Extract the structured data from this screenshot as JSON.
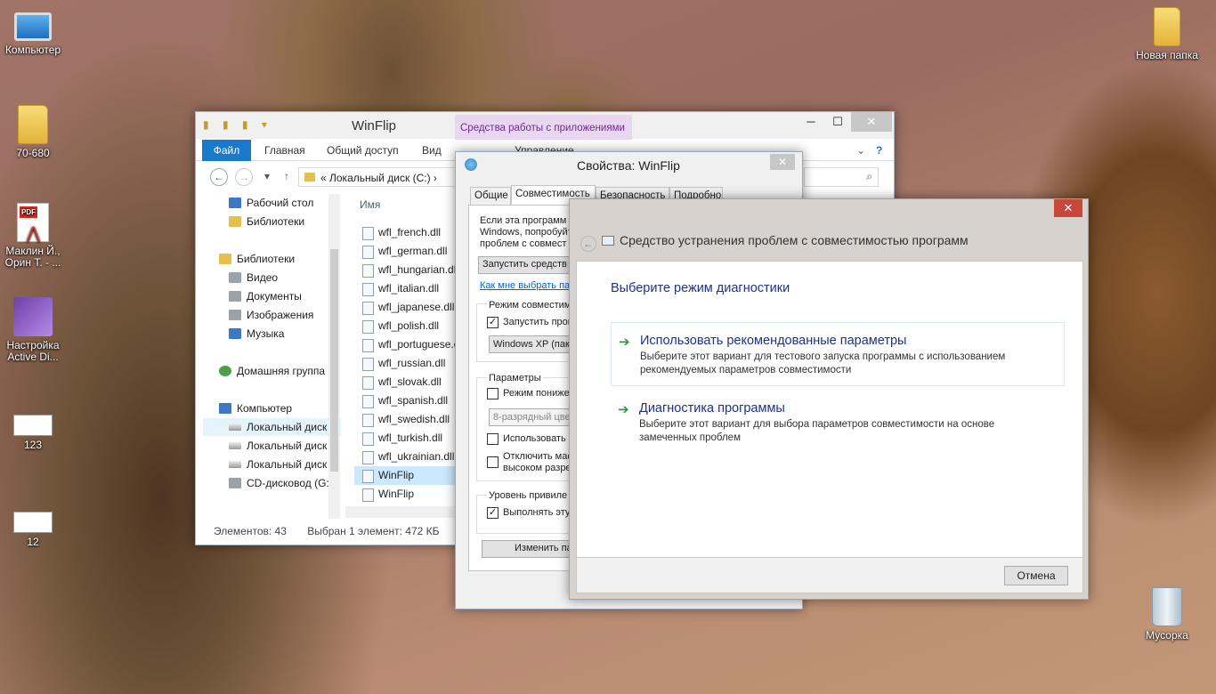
{
  "desktop": {
    "icons": [
      {
        "label": "Компьютер",
        "icon": "computer-icon"
      },
      {
        "label": "70-680",
        "icon": "pdf-folder-icon"
      },
      {
        "label": "Маклин Й., Орин Т. - ...",
        "icon": "pdf-icon"
      },
      {
        "label": "Настройка Active Di...",
        "icon": "visual-studio-icon"
      },
      {
        "label": "123",
        "icon": "document-icon"
      },
      {
        "label": "12",
        "icon": "document-icon"
      },
      {
        "label": "Новая папка",
        "icon": "folder-icon"
      },
      {
        "label": "Мусорка",
        "icon": "recycle-bin-icon"
      }
    ]
  },
  "explorer": {
    "title": "WinFlip",
    "tools_tab": "Средства работы с приложениями",
    "tools_subtab": "Управление",
    "tabs": [
      "Файл",
      "Главная",
      "Общий доступ",
      "Вид"
    ],
    "address": "«  Локальный диск (C:) ›",
    "nav": [
      {
        "label": "Рабочий стол",
        "icon": "desktop-icon"
      },
      {
        "label": "Библиотеки",
        "icon": "libraries-icon"
      },
      {
        "label": "Библиотеки",
        "icon": "libraries-icon"
      },
      {
        "label": "Видео",
        "icon": "video-icon"
      },
      {
        "label": "Документы",
        "icon": "documents-icon"
      },
      {
        "label": "Изображения",
        "icon": "pictures-icon"
      },
      {
        "label": "Музыка",
        "icon": "music-icon"
      },
      {
        "label": "Домашняя группа",
        "icon": "homegroup-icon"
      },
      {
        "label": "Компьютер",
        "icon": "computer-icon"
      },
      {
        "label": "Локальный диск",
        "icon": "drive-icon"
      },
      {
        "label": "Локальный диск",
        "icon": "drive-icon"
      },
      {
        "label": "Локальный диск",
        "icon": "drive-icon"
      },
      {
        "label": "CD-дисковод (G:",
        "icon": "cd-drive-icon"
      }
    ],
    "column_name": "Имя",
    "files": [
      "wfl_french.dll",
      "wfl_german.dll",
      "wfl_hungarian.dll",
      "wfl_italian.dll",
      "wfl_japanese.dll",
      "wfl_polish.dll",
      "wfl_portuguese.dll",
      "wfl_russian.dll",
      "wfl_slovak.dll",
      "wfl_spanish.dll",
      "wfl_swedish.dll",
      "wfl_turkish.dll",
      "wfl_ukrainian.dll",
      "WinFlip",
      "WinFlip"
    ],
    "status_count": "Элементов: 43",
    "status_selected": "Выбран 1 элемент: 472 КБ"
  },
  "properties": {
    "title": "Свойства: WinFlip",
    "tabs": [
      "Общие",
      "Совместимость",
      "Безопасность",
      "Подробно"
    ],
    "intro_line1": "Если эта программ",
    "intro_line2": "Windows, попробуйт",
    "intro_line3": "проблем с совмест",
    "run_troubleshooter": "Запустить средств",
    "help_link": "Как мне выбрать па",
    "compat_group": "Режим совместим",
    "run_compat_label": "Запустить прог",
    "os_select": "Windows XP (пакет",
    "params_group": "Параметры",
    "reduced_color": "Режим пониже",
    "color_select": "8-разрядный цве",
    "use_label": "Использовать",
    "dpi_label1": "Отключить мас",
    "dpi_label2": "высоком разре",
    "privilege_group": "Уровень привиле",
    "run_admin": "Выполнять эту",
    "change_button": "Изменить па"
  },
  "troubleshooter": {
    "title": "Средство устранения проблем с совместимостью программ",
    "question": "Выберите режим диагностики",
    "options": [
      {
        "title": "Использовать рекомендованные параметры",
        "desc": "Выберите этот вариант для тестового запуска программы с использованием рекомендуемых параметров совместимости"
      },
      {
        "title": "Диагностика программы",
        "desc": "Выберите этот вариант для выбора параметров совместимости на основе замеченных проблем"
      }
    ],
    "cancel": "Отмена"
  }
}
